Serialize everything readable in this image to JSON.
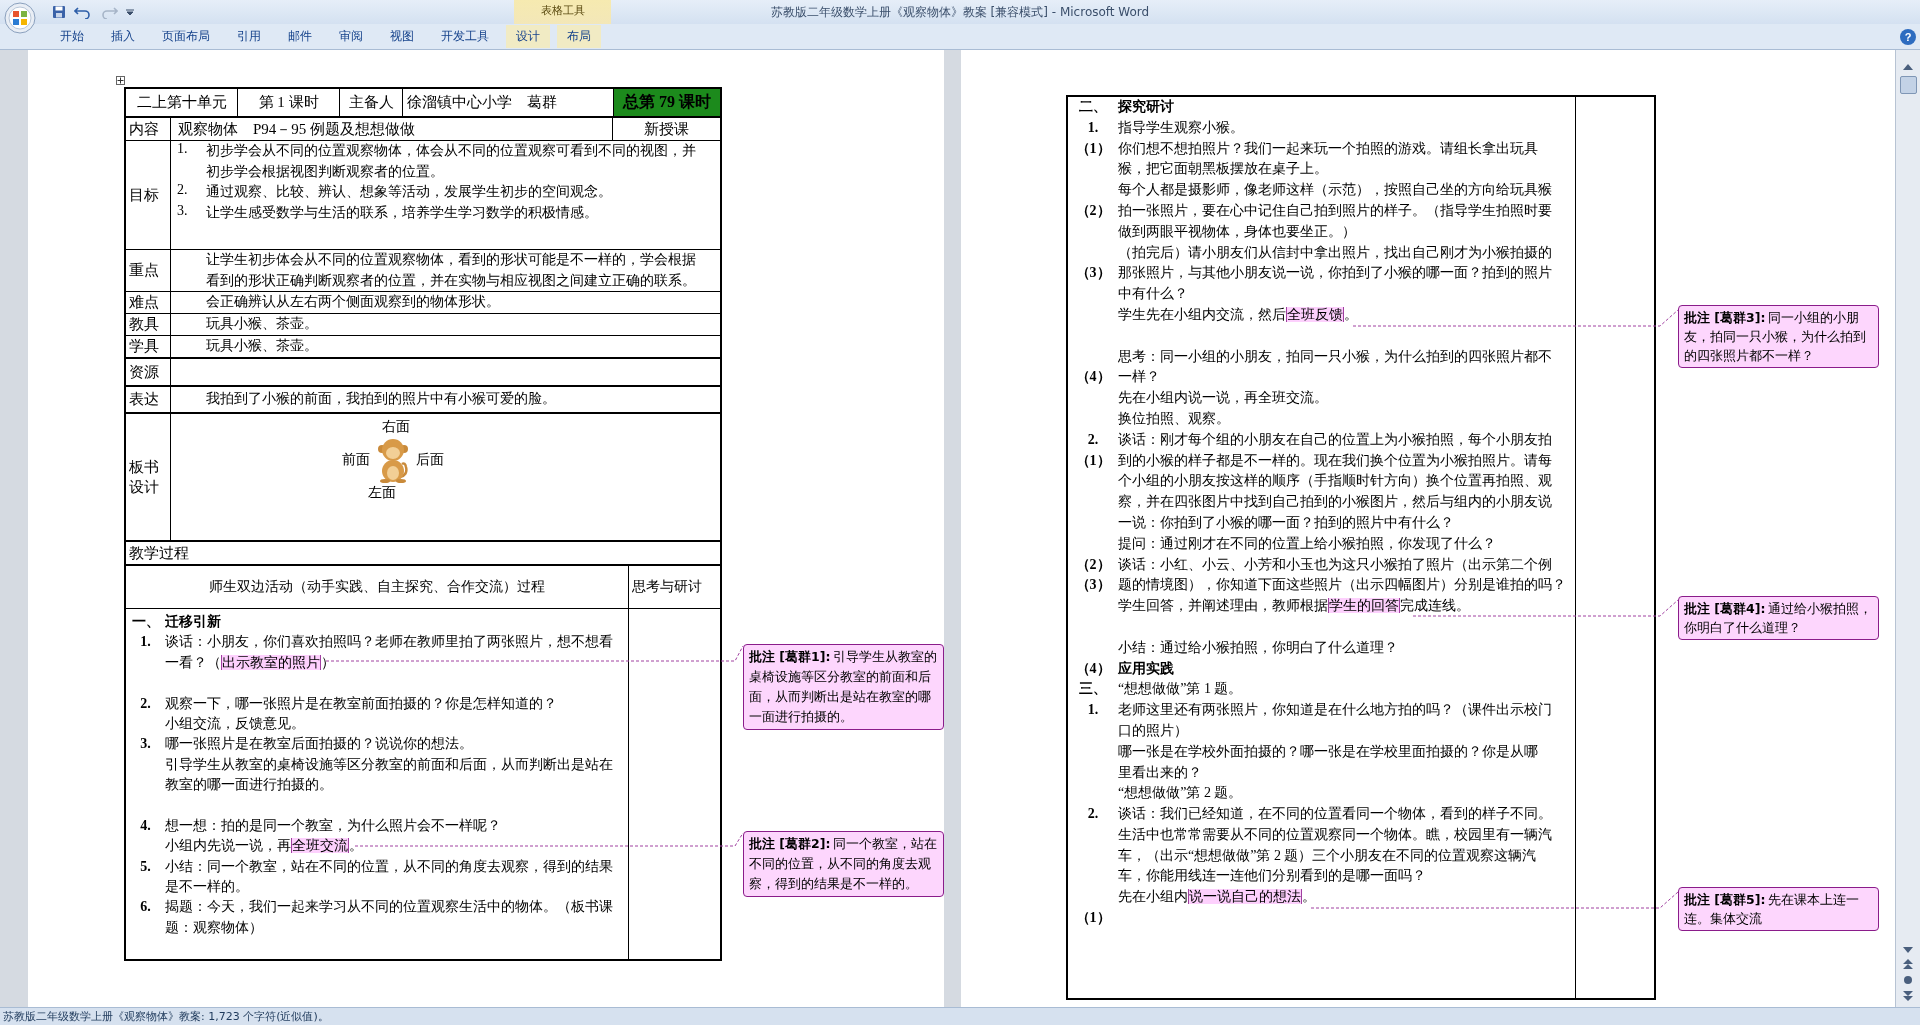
{
  "window": {
    "title": "苏教版二年级数学上册《观察物体》教案 [兼容模式] - Microsoft Word",
    "contextual_group": "表格工具",
    "help": "?"
  },
  "ribbon_tabs": [
    {
      "label": "开始",
      "kind": "normal"
    },
    {
      "label": "插入",
      "kind": "normal"
    },
    {
      "label": "页面布局",
      "kind": "normal"
    },
    {
      "label": "引用",
      "kind": "normal"
    },
    {
      "label": "邮件",
      "kind": "normal"
    },
    {
      "label": "审阅",
      "kind": "normal"
    },
    {
      "label": "视图",
      "kind": "normal"
    },
    {
      "label": "开发工具",
      "kind": "normal"
    },
    {
      "label": "设计",
      "kind": "contextual"
    },
    {
      "label": "布局",
      "kind": "contextual"
    }
  ],
  "left_page": {
    "header_cells": [
      {
        "text": "二上第十单元",
        "highlighted": false
      },
      {
        "text": "第 1 课时",
        "highlighted": false
      },
      {
        "text": "主备人",
        "highlighted": false
      },
      {
        "text": "徐溜镇中心小学　葛群",
        "highlighted": false
      },
      {
        "text": "总第 79 课时",
        "highlighted": true
      }
    ],
    "content_row": {
      "label": "内容",
      "value": "观察物体　P94－95 例题及想想做做",
      "lesson_type": "新授课"
    },
    "info_rows": [
      {
        "label": "目标",
        "items": [
          {
            "number": "1.",
            "lines": [
              "初步学会从不同的位置观察物体，体会从不同的位置观察可看到不同的视图，并",
              "初步学会根据视图判断观察者的位置。"
            ]
          },
          {
            "number": "2.",
            "lines": [
              "通过观察、比较、辨认、想象等活动，发展学生初步的空间观念。"
            ]
          },
          {
            "number": "3.",
            "lines": [
              "让学生感受数学与生活的联系，培养学生学习数学的积极情感。"
            ]
          }
        ]
      },
      {
        "label": "重点",
        "items": [
          {
            "lines": [
              "让学生初步体会从不同的位置观察物体，看到的形状可能是不一样的，学会根据",
              "看到的形状正确判断观察者的位置，并在实物与相应视图之间建立正确的联系。"
            ]
          }
        ]
      },
      {
        "label": "难点",
        "items": [
          {
            "lines": [
              "会正确辨认从左右两个侧面观察到的物体形状。"
            ]
          }
        ]
      },
      {
        "label": "教具",
        "items": [
          {
            "lines": [
              "玩具小猴、茶壶。"
            ]
          }
        ]
      },
      {
        "label": "学具",
        "items": [
          {
            "lines": [
              "玩具小猴、茶壶。"
            ]
          }
        ]
      },
      {
        "label": "资源"
      },
      {
        "label": "表达",
        "items": [
          {
            "lines": [
              "我拍到了小猴的前面，我拍到的照片中有小猴可爱的脸。"
            ]
          }
        ]
      }
    ],
    "board": {
      "label_lines": [
        "板书",
        "设计"
      ],
      "top": "右面",
      "left": "前面",
      "right": "后面",
      "bottom": "左面"
    },
    "process_title": "教学过程",
    "process_columns": [
      "师生双边活动（动手实践、自主探究、合作交流）过程",
      "思考与研讨"
    ],
    "lines": [
      {
        "kind": "text",
        "number": "一、",
        "text": "迁移引新",
        "bold": true
      },
      {
        "kind": "text",
        "number": "1.",
        "text": "谈话：小朋友，你们喜欢拍照吗？老师在教师里拍了两张照片，想不想看",
        "bold": false
      },
      {
        "kind": "text",
        "text": "一看？（",
        "anchor": "出示教室的照片",
        "tail": "）",
        "bold": false
      },
      {
        "kind": "blank"
      },
      {
        "kind": "text",
        "number": "2.",
        "text": "观察一下，哪一张照片是在教室前面拍摄的？你是怎样知道的？",
        "bold": false
      },
      {
        "kind": "text",
        "text": "小组交流，反馈意见。",
        "bold": false
      },
      {
        "kind": "text",
        "number": "3.",
        "text": "哪一张照片是在教室后面拍摄的？说说你的想法。",
        "bold": false
      },
      {
        "kind": "text",
        "text": "引导学生从教室的桌椅设施等区分教室的前面和后面，从而判断出是站在",
        "bold": false
      },
      {
        "kind": "text",
        "text": "教室的哪一面进行拍摄的。",
        "bold": false
      },
      {
        "kind": "blank"
      },
      {
        "kind": "text",
        "number": "4.",
        "text": "想一想：拍的是同一个教室，为什么照片会不一样呢？",
        "bold": false
      },
      {
        "kind": "text",
        "text": "小组内先说一说，再",
        "anchor": "全班交流",
        "tail": "。",
        "bold": false
      },
      {
        "kind": "text",
        "number": "5.",
        "text": "小结：同一个教室，站在不同的位置，从不同的角度去观察，得到的结果",
        "bold": false
      },
      {
        "kind": "text",
        "text": "是不一样的。",
        "bold": false
      },
      {
        "kind": "text",
        "number": "6.",
        "text": "揭题：今天，我们一起来学习从不同的位置观察生活中的物体。（板书课",
        "bold": false
      },
      {
        "kind": "text",
        "text": "题：观察物体）",
        "bold": false
      },
      {
        "kind": "blank"
      }
    ],
    "comments": [
      {
        "label": "批注 [葛群1]:",
        "text": "引导学生从教室的桌椅设施等区分教室的前面和后面，从而判断出是站在教室的哪一面进行拍摄的。"
      },
      {
        "label": "批注 [葛群2]:",
        "text": "同一个教室，站在不同的位置，从不同的角度去观察，得到的结果是不一样的。"
      }
    ]
  },
  "right_page": {
    "lines": [
      {
        "kind": "text",
        "number": "二、",
        "text": "探究研讨",
        "bold": true
      },
      {
        "kind": "text",
        "number": "1.",
        "text": "指导学生观察小猴。",
        "bold": false
      },
      {
        "kind": "text",
        "number": "（1）",
        "text": "你们想不想拍照片？我们一起来玩一个拍照的游戏。请组长拿出玩具",
        "bold": false
      },
      {
        "kind": "text",
        "text": "猴，把它面朝黑板摆放在桌子上。",
        "bold": false
      },
      {
        "kind": "text",
        "text": "每个人都是摄影师，像老师这样（示范），按照自己坐的方向给玩具猴",
        "bold": false
      },
      {
        "kind": "text",
        "number": "（2）",
        "text": "拍一张照片，要在心中记住自己拍到照片的样子。（指导学生拍照时要",
        "bold": false
      },
      {
        "kind": "text",
        "text": "做到两眼平视物体，身体也要坐正。）",
        "bold": false
      },
      {
        "kind": "text",
        "text": "（拍完后）请小朋友们从信封中拿出照片，找出自己刚才为小猴拍摄的",
        "bold": false
      },
      {
        "kind": "text",
        "number": "（3）",
        "text": "那张照片，与其他小朋友说一说，你拍到了小猴的哪一面？拍到的照片",
        "bold": false
      },
      {
        "kind": "text",
        "text": "中有什么？",
        "bold": false
      },
      {
        "kind": "text",
        "text": "学生先在小组内交流，然后",
        "anchor": "全班反馈",
        "tail": "。",
        "bold": false
      },
      {
        "kind": "blank"
      },
      {
        "kind": "text",
        "text": "思考：同一小组的小朋友，拍同一只小猴，为什么拍到的四张照片都不",
        "bold": false
      },
      {
        "kind": "text",
        "number": "（4）",
        "text": "一样？",
        "bold": false
      },
      {
        "kind": "text",
        "text": "先在小组内说一说，再全班交流。",
        "bold": false
      },
      {
        "kind": "text",
        "text": "换位拍照、观察。",
        "bold": false
      },
      {
        "kind": "text",
        "number": "2.",
        "text": "谈话：刚才每个组的小朋友在自己的位置上为小猴拍照，每个小朋友拍",
        "bold": false
      },
      {
        "kind": "text",
        "number": "（1）",
        "text": "到的小猴的样子都是不一样的。现在我们换个位置为小猴拍照片。请每",
        "bold": false
      },
      {
        "kind": "text",
        "text": "个小组的小朋友按这样的顺序（手指顺时针方向）换个位置再拍照、观",
        "bold": false
      },
      {
        "kind": "text",
        "text": "察，并在四张图片中找到自己拍到的小猴图片，然后与组内的小朋友说",
        "bold": false
      },
      {
        "kind": "text",
        "text": "一说：你拍到了小猴的哪一面？拍到的照片中有什么？",
        "bold": false
      },
      {
        "kind": "text",
        "text": "提问：通过刚才在不同的位置上给小猴拍照，你发现了什么？",
        "bold": false
      },
      {
        "kind": "text",
        "number": "（2）",
        "text": "谈话：小红、小云、小芳和小玉也为这只小猴拍了照片（出示第二个例",
        "bold": false
      },
      {
        "kind": "text",
        "number": "（3）",
        "text": "题的情境图），你知道下面这些照片（出示四幅图片）分别是谁拍的吗？",
        "bold": false
      },
      {
        "kind": "text",
        "text": "学生回答，并阐述理由，教师根据",
        "anchor": "学生的回答",
        "tail": "完成连线。",
        "bold": false
      },
      {
        "kind": "blank"
      },
      {
        "kind": "text",
        "text": "小结：通过给小猴拍照，你明白了什么道理？",
        "bold": false
      },
      {
        "kind": "text",
        "number": "（4）",
        "text": "应用实践",
        "bold": true
      },
      {
        "kind": "text",
        "number": "三、",
        "text": "“想想做做”第 1 题。",
        "bold": false
      },
      {
        "kind": "text",
        "number": "1.",
        "text": "老师这里还有两张照片，你知道是在什么地方拍的吗？（课件出示校门",
        "bold": false
      },
      {
        "kind": "text",
        "text": "口的照片）",
        "bold": false
      },
      {
        "kind": "text",
        "text": "哪一张是在学校外面拍摄的？哪一张是在学校里面拍摄的？你是从哪",
        "bold": false
      },
      {
        "kind": "text",
        "text": "里看出来的？",
        "bold": false
      },
      {
        "kind": "text",
        "text": "“想想做做”第 2 题。",
        "bold": false
      },
      {
        "kind": "text",
        "number": "2.",
        "text": "谈话：我们已经知道，在不同的位置看同一个物体，看到的样子不同。",
        "bold": false
      },
      {
        "kind": "text",
        "text": "生活中也常常需要从不同的位置观察同一个物体。瞧，校园里有一辆汽",
        "bold": false
      },
      {
        "kind": "text",
        "text": "车，（出示“想想做做”第 2 题）三个小朋友在不同的位置观察这辆汽",
        "bold": false
      },
      {
        "kind": "text",
        "text": "车，你能用线连一连他们分别看到的是哪一面吗？",
        "bold": false
      },
      {
        "kind": "text",
        "text": "先在小组内",
        "anchor": "说一说自己的想法",
        "tail": "。",
        "bold": false
      },
      {
        "kind": "text",
        "number": "（1）"
      },
      {
        "kind": "blank"
      }
    ],
    "comments": [
      {
        "label": "批注 [葛群3]:",
        "text": "同一小组的小朋友，拍同一只小猴，为什么拍到的四张照片都不一样？"
      },
      {
        "label": "批注 [葛群4]:",
        "text": "通过给小猴拍照，你明白了什么道理？"
      },
      {
        "label": "批注 [葛群5]:",
        "text": "先在课本上连一连。集体交流"
      }
    ]
  },
  "status_bar": "苏教版二年级数学上册《观察物体》教案: 1,723 个字符(近似值)。"
}
